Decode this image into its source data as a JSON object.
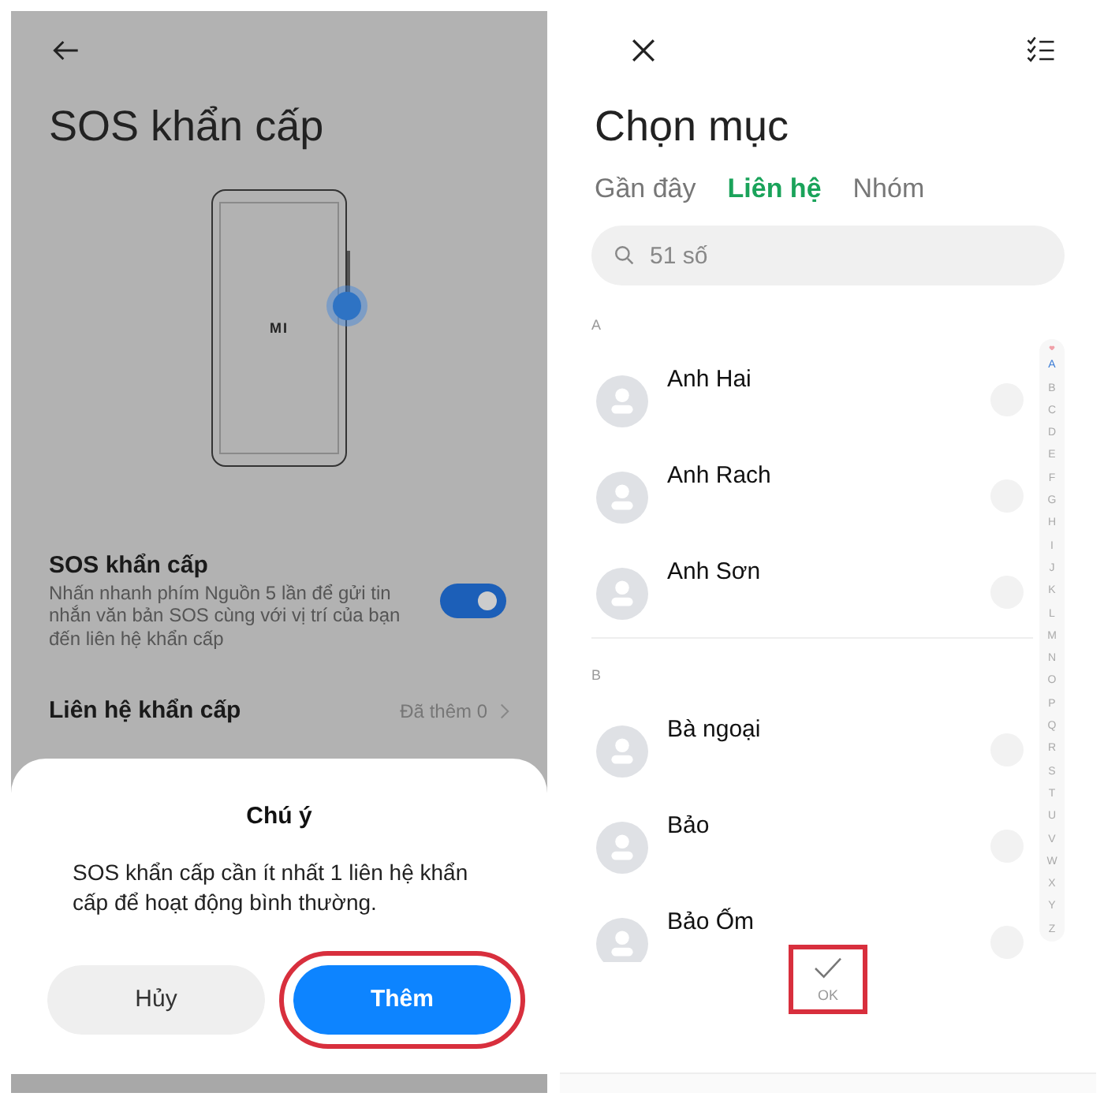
{
  "left_screen": {
    "title": "SOS khẩn cấp",
    "phone_logo": "MI",
    "setting": {
      "title": "SOS khẩn cấp",
      "description": "Nhấn nhanh phím Nguồn 5 lần để gửi tin nhắn văn bản SOS cùng với vị trí của bạn đến liên hệ khẩn cấp",
      "on": true
    },
    "contact_row": {
      "label": "Liên hệ khẩn cấp",
      "value": "Đã thêm 0"
    },
    "dialog": {
      "title": "Chú ý",
      "message": "SOS khẩn cấp cần ít nhất 1 liên hệ khẩn cấp để hoạt động bình thường.",
      "buttons": [
        {
          "label": "Hủy",
          "kind": "secondary",
          "highlighted": false
        },
        {
          "label": "Thêm",
          "kind": "primary",
          "highlighted": true
        }
      ]
    }
  },
  "right_screen": {
    "title": "Chọn mục",
    "tabs": [
      {
        "label": "Gần đây",
        "selected": false
      },
      {
        "label": "Liên hệ",
        "selected": true
      },
      {
        "label": "Nhóm",
        "selected": false
      }
    ],
    "search": {
      "placeholder": "51 số"
    },
    "sections": [
      {
        "letter": "A",
        "contacts": [
          {
            "name": "Anh Hai",
            "checked": false
          },
          {
            "name": "Anh Rach",
            "checked": false
          },
          {
            "name": "Anh Sơn",
            "checked": false
          }
        ]
      },
      {
        "letter": "B",
        "contacts": [
          {
            "name": "Bà ngoại",
            "checked": false
          },
          {
            "name": "Bảo",
            "checked": false
          },
          {
            "name": "Bảo Ốm",
            "checked": false
          }
        ]
      }
    ],
    "index": [
      {
        "label": "A",
        "selected": true
      },
      {
        "label": "B",
        "selected": false
      },
      {
        "label": "C",
        "selected": false
      },
      {
        "label": "D",
        "selected": false
      },
      {
        "label": "E",
        "selected": false
      },
      {
        "label": "F",
        "selected": false
      },
      {
        "label": "G",
        "selected": false
      },
      {
        "label": "H",
        "selected": false
      },
      {
        "label": "I",
        "selected": false
      },
      {
        "label": "J",
        "selected": false
      },
      {
        "label": "K",
        "selected": false
      },
      {
        "label": "L",
        "selected": false
      },
      {
        "label": "M",
        "selected": false
      },
      {
        "label": "N",
        "selected": false
      },
      {
        "label": "O",
        "selected": false
      },
      {
        "label": "P",
        "selected": false
      },
      {
        "label": "Q",
        "selected": false
      },
      {
        "label": "R",
        "selected": false
      },
      {
        "label": "S",
        "selected": false
      },
      {
        "label": "T",
        "selected": false
      },
      {
        "label": "U",
        "selected": false
      },
      {
        "label": "V",
        "selected": false
      },
      {
        "label": "W",
        "selected": false
      },
      {
        "label": "X",
        "selected": false
      },
      {
        "label": "Y",
        "selected": false
      },
      {
        "label": "Z",
        "selected": false
      }
    ],
    "ok_button": {
      "label": "OK",
      "highlighted": true
    }
  }
}
